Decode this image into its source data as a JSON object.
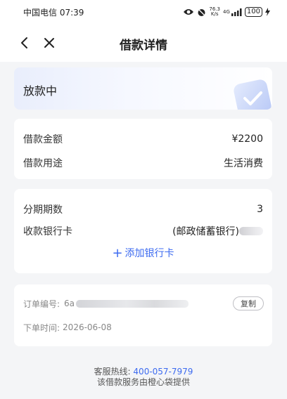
{
  "status_bar": {
    "carrier": "中国电信",
    "time": "07:39",
    "net_speed_top": "76.3",
    "net_speed_bottom": "K/s",
    "network": "4G",
    "battery": "100"
  },
  "nav": {
    "title": "借款详情"
  },
  "loan_status": {
    "text": "放款中"
  },
  "amount_card": {
    "rows": [
      {
        "label": "借款金额",
        "value": "¥2200"
      },
      {
        "label": "借款用途",
        "value": "生活消费"
      }
    ]
  },
  "installment_card": {
    "periods_label": "分期期数",
    "periods_value": "3",
    "bank_label": "收款银行卡",
    "bank_value": "(邮政储蓄银行)",
    "add_card_icon": "plus-icon",
    "add_card_label": "添加银行卡"
  },
  "order_card": {
    "order_no_label": "订单编号:",
    "order_no_prefix": "6a",
    "copy_label": "复制",
    "time_label": "下单时间:",
    "time_value": "2026-06-08"
  },
  "footer": {
    "hotline_label": "客服热线:",
    "hotline_number": "400-057-7979",
    "provider_text": "该借款服务由橙心袋提供"
  },
  "colors": {
    "accent": "#3d6bf0",
    "background": "#f4f5f7"
  }
}
